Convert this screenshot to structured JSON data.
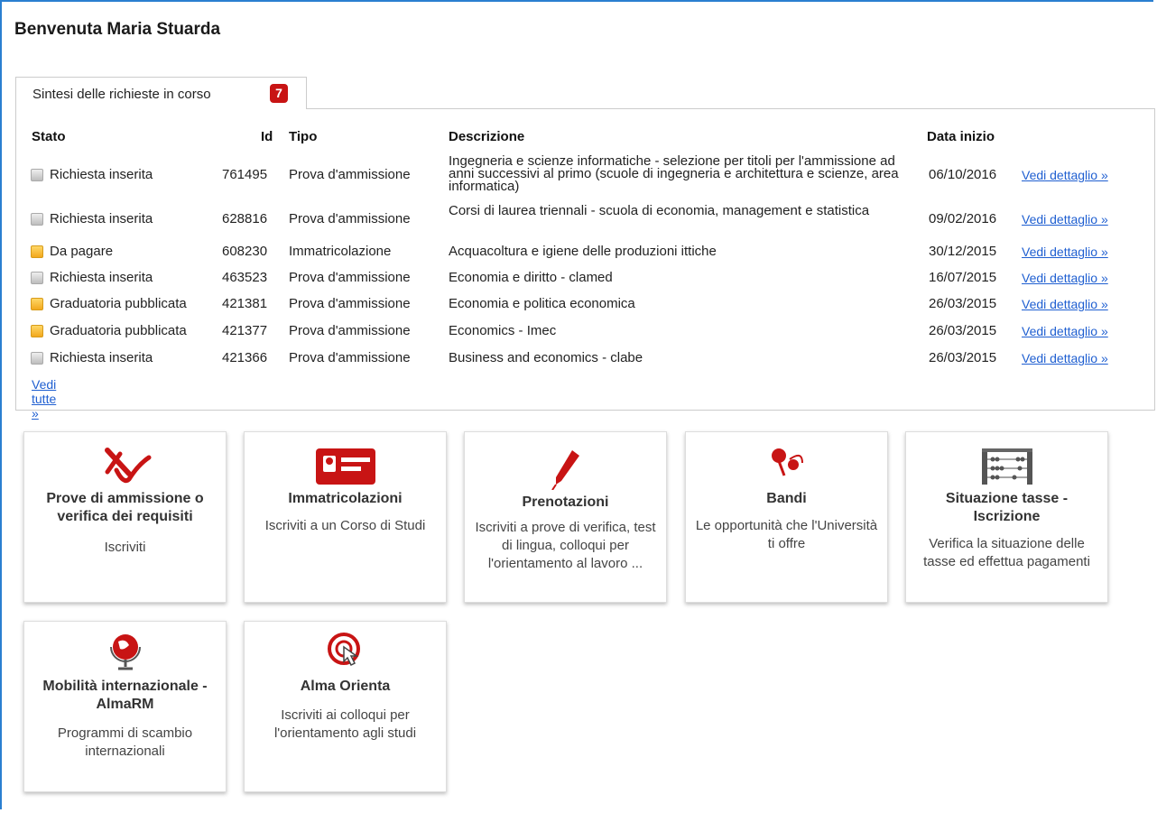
{
  "page_title": "Benvenuta Maria Stuarda",
  "tab": {
    "label": "Sintesi delle richieste in corso",
    "badge": "7"
  },
  "table": {
    "headers": {
      "stato": "Stato",
      "id": "Id",
      "tipo": "Tipo",
      "descrizione": "Descrizione",
      "data_inizio": "Data inizio"
    },
    "rows": [
      {
        "stato": "Richiesta inserita",
        "status_color": "grey",
        "id": "761495",
        "tipo": "Prova d'ammissione",
        "descrizione": "Ingegneria e scienze informatiche - selezione per titoli per l'ammissione ad anni successivi al primo (scuole di ingegneria e architettura e scienze, area informatica)",
        "data": "06/10/2016",
        "link": "Vedi dettaglio »"
      },
      {
        "stato": "Richiesta inserita",
        "status_color": "grey",
        "id": "628816",
        "tipo": "Prova d'ammissione",
        "descrizione": "Corsi di laurea triennali - scuola di economia, management e statistica",
        "data": "09/02/2016",
        "link": "Vedi dettaglio »"
      },
      {
        "stato": "Da pagare",
        "status_color": "yellow",
        "id": "608230",
        "tipo": "Immatricolazione",
        "descrizione": "Acquacoltura e igiene delle produzioni ittiche",
        "data": "30/12/2015",
        "link": "Vedi dettaglio »"
      },
      {
        "stato": "Richiesta inserita",
        "status_color": "grey",
        "id": "463523",
        "tipo": "Prova d'ammissione",
        "descrizione": "Economia e diritto - clamed",
        "data": "16/07/2015",
        "link": "Vedi dettaglio »"
      },
      {
        "stato": "Graduatoria pubblicata",
        "status_color": "yellow",
        "id": "421381",
        "tipo": "Prova d'ammissione",
        "descrizione": "Economia e politica economica",
        "data": "26/03/2015",
        "link": "Vedi dettaglio »"
      },
      {
        "stato": "Graduatoria pubblicata",
        "status_color": "yellow",
        "id": "421377",
        "tipo": "Prova d'ammissione",
        "descrizione": "Economics - Imec",
        "data": "26/03/2015",
        "link": "Vedi dettaglio »"
      },
      {
        "stato": "Richiesta inserita",
        "status_color": "grey",
        "id": "421366",
        "tipo": "Prova d'ammissione",
        "descrizione": "Business and economics - clabe",
        "data": "26/03/2015",
        "link": "Vedi dettaglio »"
      }
    ],
    "see_all": "Vedi tutte »"
  },
  "cards": [
    {
      "title": "Prove di ammissione o verifica dei requisiti",
      "desc": "Iscriviti",
      "icon": "check-cross-icon"
    },
    {
      "title": "Immatricolazioni",
      "desc": "Iscriviti a un Corso di Studi",
      "icon": "id-card-icon"
    },
    {
      "title": "Prenotazioni",
      "desc": "Iscriviti a prove di verifica, test di lingua, colloqui per l'orientamento al lavoro ...",
      "icon": "pen-icon"
    },
    {
      "title": "Bandi",
      "desc": "Le opportunità che l'Università ti offre",
      "icon": "pushpin-icon"
    },
    {
      "title": "Situazione tasse - Iscrizione",
      "desc": "Verifica la situazione delle tasse ed effettua pagamenti",
      "icon": "abacus-icon"
    },
    {
      "title": "Mobilità internazionale - AlmaRM",
      "desc": "Programmi di scambio internazionali",
      "icon": "globe-icon"
    },
    {
      "title": "Alma Orienta",
      "desc": "Iscriviti ai colloqui per l'orientamento agli studi",
      "icon": "touch-target-icon"
    }
  ],
  "colors": {
    "accent_red": "#c81414",
    "link_blue": "#1f5fd1",
    "frame_blue": "#2a7fd0"
  }
}
